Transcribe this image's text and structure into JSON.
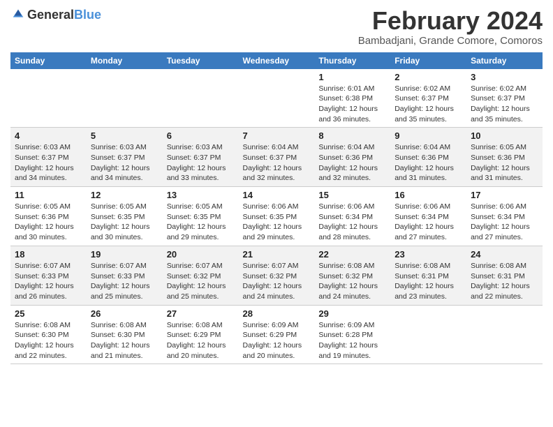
{
  "header": {
    "logo_general": "General",
    "logo_blue": "Blue",
    "title": "February 2024",
    "subtitle": "Bambadjani, Grande Comore, Comoros"
  },
  "calendar": {
    "days_of_week": [
      "Sunday",
      "Monday",
      "Tuesday",
      "Wednesday",
      "Thursday",
      "Friday",
      "Saturday"
    ],
    "weeks": [
      [
        {
          "day": "",
          "info": ""
        },
        {
          "day": "",
          "info": ""
        },
        {
          "day": "",
          "info": ""
        },
        {
          "day": "",
          "info": ""
        },
        {
          "day": "1",
          "info": "Sunrise: 6:01 AM\nSunset: 6:38 PM\nDaylight: 12 hours\nand 36 minutes."
        },
        {
          "day": "2",
          "info": "Sunrise: 6:02 AM\nSunset: 6:37 PM\nDaylight: 12 hours\nand 35 minutes."
        },
        {
          "day": "3",
          "info": "Sunrise: 6:02 AM\nSunset: 6:37 PM\nDaylight: 12 hours\nand 35 minutes."
        }
      ],
      [
        {
          "day": "4",
          "info": "Sunrise: 6:03 AM\nSunset: 6:37 PM\nDaylight: 12 hours\nand 34 minutes."
        },
        {
          "day": "5",
          "info": "Sunrise: 6:03 AM\nSunset: 6:37 PM\nDaylight: 12 hours\nand 34 minutes."
        },
        {
          "day": "6",
          "info": "Sunrise: 6:03 AM\nSunset: 6:37 PM\nDaylight: 12 hours\nand 33 minutes."
        },
        {
          "day": "7",
          "info": "Sunrise: 6:04 AM\nSunset: 6:37 PM\nDaylight: 12 hours\nand 32 minutes."
        },
        {
          "day": "8",
          "info": "Sunrise: 6:04 AM\nSunset: 6:36 PM\nDaylight: 12 hours\nand 32 minutes."
        },
        {
          "day": "9",
          "info": "Sunrise: 6:04 AM\nSunset: 6:36 PM\nDaylight: 12 hours\nand 31 minutes."
        },
        {
          "day": "10",
          "info": "Sunrise: 6:05 AM\nSunset: 6:36 PM\nDaylight: 12 hours\nand 31 minutes."
        }
      ],
      [
        {
          "day": "11",
          "info": "Sunrise: 6:05 AM\nSunset: 6:36 PM\nDaylight: 12 hours\nand 30 minutes."
        },
        {
          "day": "12",
          "info": "Sunrise: 6:05 AM\nSunset: 6:35 PM\nDaylight: 12 hours\nand 30 minutes."
        },
        {
          "day": "13",
          "info": "Sunrise: 6:05 AM\nSunset: 6:35 PM\nDaylight: 12 hours\nand 29 minutes."
        },
        {
          "day": "14",
          "info": "Sunrise: 6:06 AM\nSunset: 6:35 PM\nDaylight: 12 hours\nand 29 minutes."
        },
        {
          "day": "15",
          "info": "Sunrise: 6:06 AM\nSunset: 6:34 PM\nDaylight: 12 hours\nand 28 minutes."
        },
        {
          "day": "16",
          "info": "Sunrise: 6:06 AM\nSunset: 6:34 PM\nDaylight: 12 hours\nand 27 minutes."
        },
        {
          "day": "17",
          "info": "Sunrise: 6:06 AM\nSunset: 6:34 PM\nDaylight: 12 hours\nand 27 minutes."
        }
      ],
      [
        {
          "day": "18",
          "info": "Sunrise: 6:07 AM\nSunset: 6:33 PM\nDaylight: 12 hours\nand 26 minutes."
        },
        {
          "day": "19",
          "info": "Sunrise: 6:07 AM\nSunset: 6:33 PM\nDaylight: 12 hours\nand 25 minutes."
        },
        {
          "day": "20",
          "info": "Sunrise: 6:07 AM\nSunset: 6:32 PM\nDaylight: 12 hours\nand 25 minutes."
        },
        {
          "day": "21",
          "info": "Sunrise: 6:07 AM\nSunset: 6:32 PM\nDaylight: 12 hours\nand 24 minutes."
        },
        {
          "day": "22",
          "info": "Sunrise: 6:08 AM\nSunset: 6:32 PM\nDaylight: 12 hours\nand 24 minutes."
        },
        {
          "day": "23",
          "info": "Sunrise: 6:08 AM\nSunset: 6:31 PM\nDaylight: 12 hours\nand 23 minutes."
        },
        {
          "day": "24",
          "info": "Sunrise: 6:08 AM\nSunset: 6:31 PM\nDaylight: 12 hours\nand 22 minutes."
        }
      ],
      [
        {
          "day": "25",
          "info": "Sunrise: 6:08 AM\nSunset: 6:30 PM\nDaylight: 12 hours\nand 22 minutes."
        },
        {
          "day": "26",
          "info": "Sunrise: 6:08 AM\nSunset: 6:30 PM\nDaylight: 12 hours\nand 21 minutes."
        },
        {
          "day": "27",
          "info": "Sunrise: 6:08 AM\nSunset: 6:29 PM\nDaylight: 12 hours\nand 20 minutes."
        },
        {
          "day": "28",
          "info": "Sunrise: 6:09 AM\nSunset: 6:29 PM\nDaylight: 12 hours\nand 20 minutes."
        },
        {
          "day": "29",
          "info": "Sunrise: 6:09 AM\nSunset: 6:28 PM\nDaylight: 12 hours\nand 19 minutes."
        },
        {
          "day": "",
          "info": ""
        },
        {
          "day": "",
          "info": ""
        }
      ]
    ]
  }
}
